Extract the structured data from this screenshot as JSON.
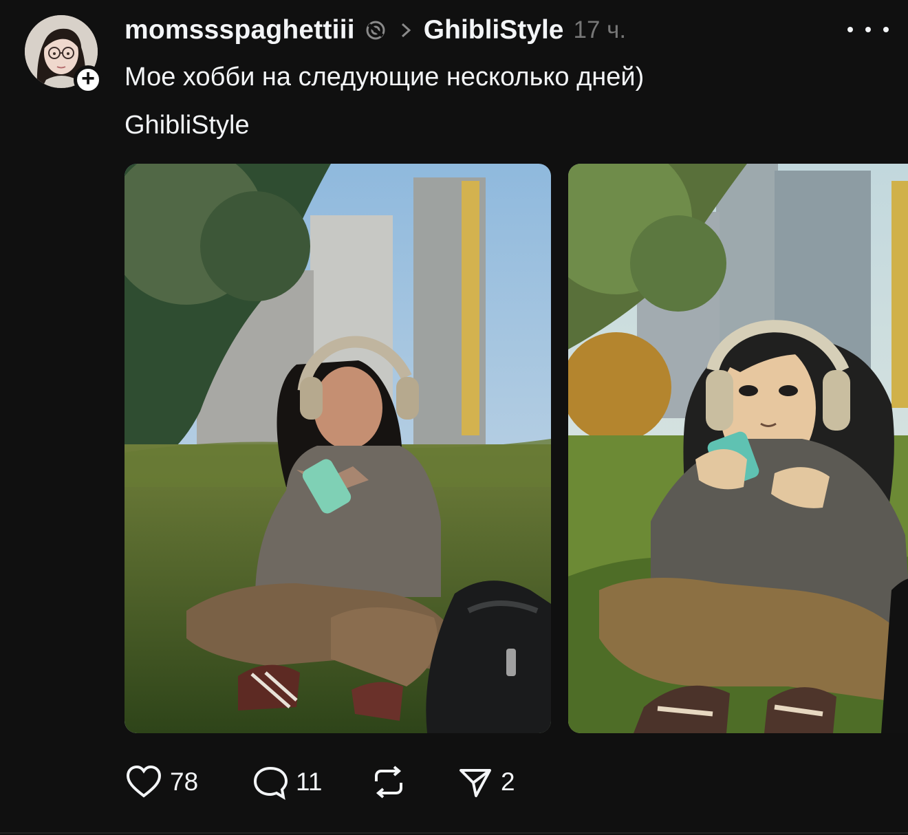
{
  "author": {
    "username": "momssspaghettiii",
    "avatar": "user-avatar",
    "follow_icon": "plus-icon"
  },
  "post": {
    "topic": "GhibliStyle",
    "timestamp": "17 ч.",
    "text": "Мое хобби на следующие несколько дней)",
    "hashtag": "GhibliStyle",
    "media": [
      {
        "kind": "photo"
      },
      {
        "kind": "anime-illustration"
      }
    ]
  },
  "actions": {
    "likes": "78",
    "comments": "11",
    "shares": "2",
    "icons": [
      "heart-icon",
      "comment-icon",
      "repost-icon",
      "share-icon"
    ]
  },
  "header_icons": [
    "thread-icon",
    "chevron-right-icon",
    "more-icon"
  ],
  "colors": {
    "background": "#101010",
    "text": "#f3f5f7",
    "muted": "#777777"
  }
}
